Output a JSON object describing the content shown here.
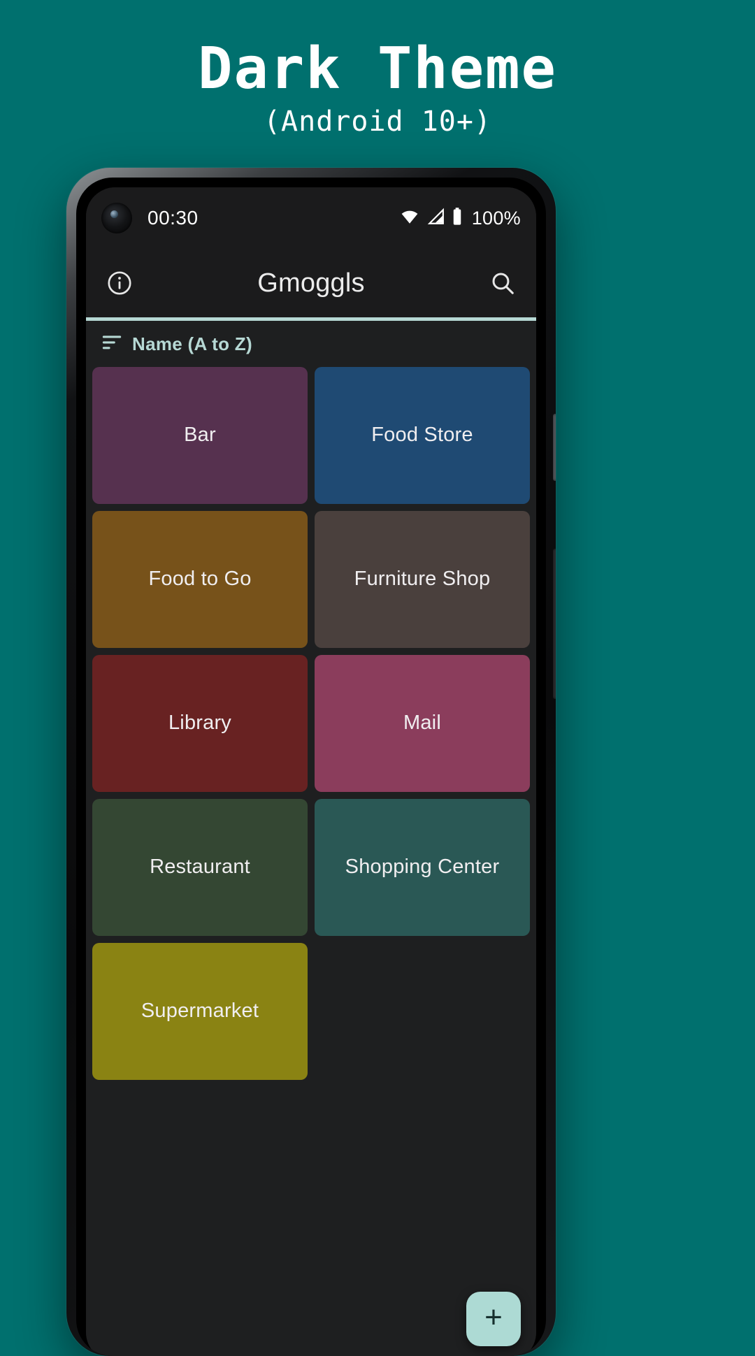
{
  "promo": {
    "title": "Dark Theme",
    "subtitle": "(Android 10+)"
  },
  "colors": {
    "background": "#00706e",
    "accent": "#b6d8d4",
    "screen_bg": "#1e1f20",
    "appbar_bg": "#1b1b1c",
    "fab_bg": "#addad4"
  },
  "statusbar": {
    "clock": "00:30",
    "battery_percent": "100%",
    "wifi_icon": "wifi-icon",
    "signal_icon": "cell-signal-icon",
    "battery_icon": "battery-full-icon"
  },
  "appbar": {
    "info_icon": "info-icon",
    "title": "Gmoggls",
    "search_icon": "search-icon"
  },
  "sort": {
    "icon": "sort-icon",
    "label": "Name (A to Z)"
  },
  "tiles": [
    {
      "label": "Bar",
      "color": "#56314f"
    },
    {
      "label": "Food Store",
      "color": "#1f4a73"
    },
    {
      "label": "Food to Go",
      "color": "#77521a"
    },
    {
      "label": "Furniture Shop",
      "color": "#4a403d"
    },
    {
      "label": "Library",
      "color": "#682222"
    },
    {
      "label": "Mail",
      "color": "#8b3d5c"
    },
    {
      "label": "Restaurant",
      "color": "#344733"
    },
    {
      "label": "Shopping Center",
      "color": "#2a5855"
    },
    {
      "label": "Supermarket",
      "color": "#8a8313"
    }
  ],
  "fab": {
    "label": "+",
    "icon": "plus-icon"
  }
}
